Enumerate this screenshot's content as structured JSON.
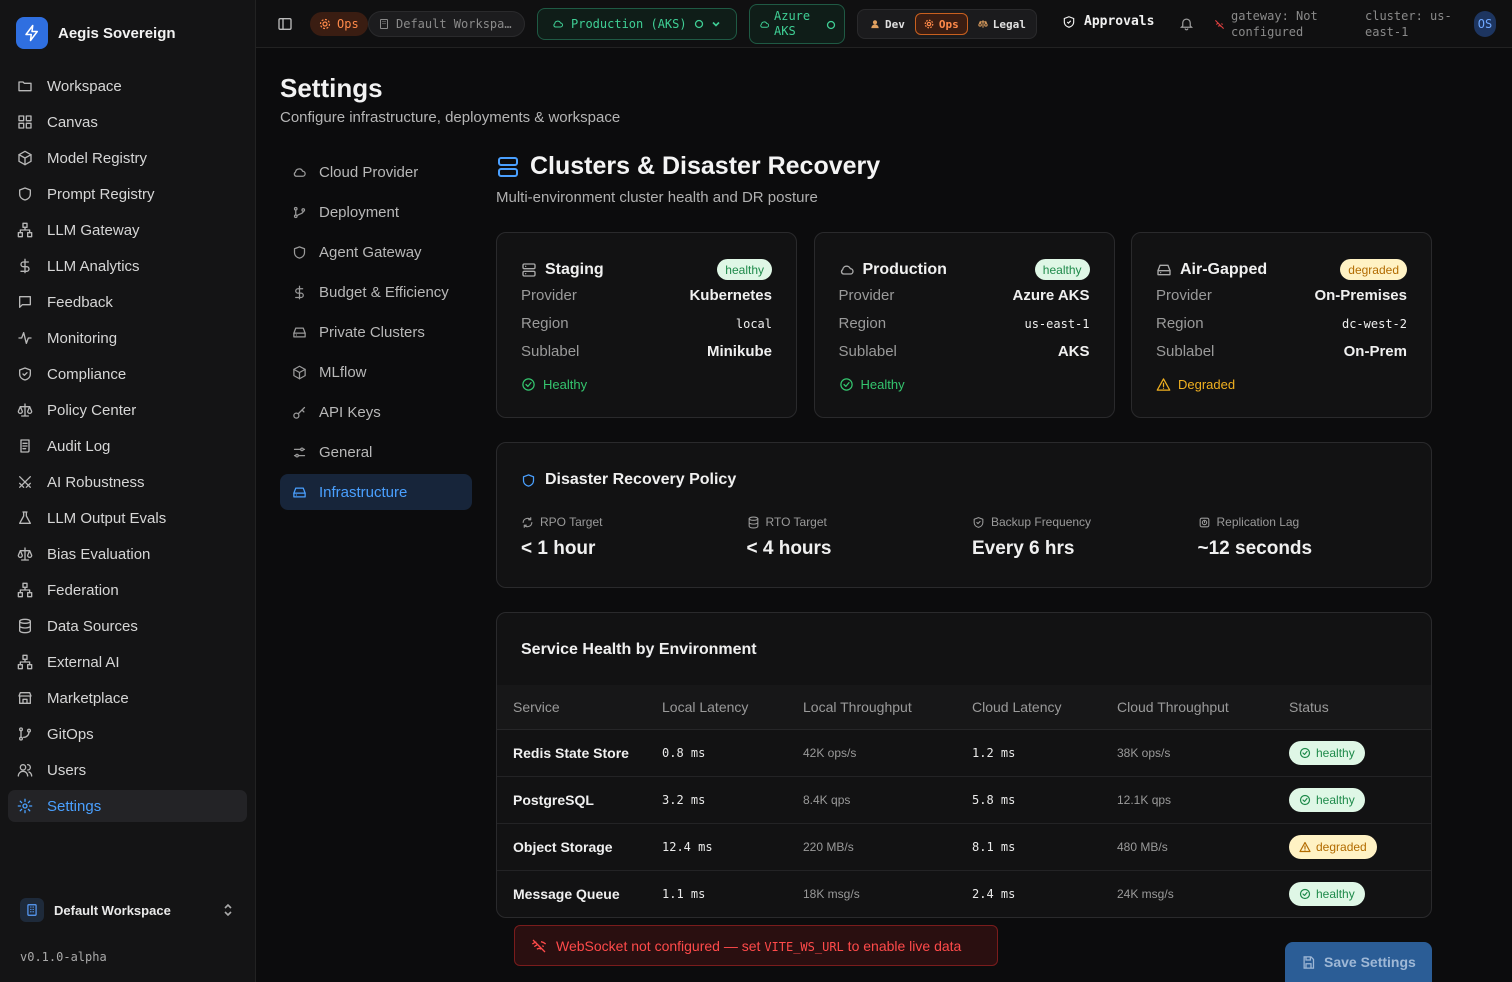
{
  "brand": {
    "name": "Aegis Sovereign"
  },
  "sidebar": {
    "items": [
      {
        "label": "Workspace",
        "icon": "folder-icon",
        "name": "workspace"
      },
      {
        "label": "Canvas",
        "icon": "grid-icon",
        "name": "canvas"
      },
      {
        "label": "Model Registry",
        "icon": "cube-icon",
        "name": "model-registry"
      },
      {
        "label": "Prompt Registry",
        "icon": "shield-icon",
        "name": "prompt-registry"
      },
      {
        "label": "LLM Gateway",
        "icon": "network-icon",
        "name": "llm-gateway"
      },
      {
        "label": "LLM Analytics",
        "icon": "dollar-icon",
        "name": "llm-analytics"
      },
      {
        "label": "Feedback",
        "icon": "message-icon",
        "name": "feedback"
      },
      {
        "label": "Monitoring",
        "icon": "activity-icon",
        "name": "monitoring"
      },
      {
        "label": "Compliance",
        "icon": "shield-check-icon",
        "name": "compliance"
      },
      {
        "label": "Policy Center",
        "icon": "scale-icon",
        "name": "policy-center"
      },
      {
        "label": "Audit Log",
        "icon": "scroll-icon",
        "name": "audit-log"
      },
      {
        "label": "AI Robustness",
        "icon": "swords-icon",
        "name": "ai-robustness"
      },
      {
        "label": "LLM Output Evals",
        "icon": "flask-icon",
        "name": "llm-output-evals"
      },
      {
        "label": "Bias Evaluation",
        "icon": "scale-icon",
        "name": "bias-evaluation"
      },
      {
        "label": "Federation",
        "icon": "network-icon",
        "name": "federation"
      },
      {
        "label": "Data Sources",
        "icon": "database-icon",
        "name": "data-sources"
      },
      {
        "label": "External AI",
        "icon": "network-icon",
        "name": "external-ai"
      },
      {
        "label": "Marketplace",
        "icon": "store-icon",
        "name": "marketplace"
      },
      {
        "label": "GitOps",
        "icon": "git-branch-icon",
        "name": "gitops"
      },
      {
        "label": "Users",
        "icon": "users-icon",
        "name": "users"
      },
      {
        "label": "Settings",
        "icon": "gear-icon",
        "name": "settings",
        "active": true
      }
    ],
    "workspace": "Default Workspace",
    "version": "v0.1.0-alpha"
  },
  "topbar": {
    "role_badge": "Ops",
    "workspace": "Default Workspa…",
    "environment": "Production (AKS)",
    "cloud": "Azure AKS",
    "roles": [
      "Dev",
      "Ops",
      "Legal"
    ],
    "approvals": "Approvals",
    "gateway": "gateway: Not configured",
    "cluster": "cluster: us-east-1",
    "avatar": "OS"
  },
  "page": {
    "title": "Settings",
    "subtitle": "Configure infrastructure, deployments & workspace"
  },
  "settings_nav": [
    {
      "label": "Cloud Provider",
      "icon": "cloud-icon"
    },
    {
      "label": "Deployment",
      "icon": "git-icon"
    },
    {
      "label": "Agent Gateway",
      "icon": "shield-icon"
    },
    {
      "label": "Budget & Efficiency",
      "icon": "dollar-icon"
    },
    {
      "label": "Private Clusters",
      "icon": "hard-drive-icon"
    },
    {
      "label": "MLflow",
      "icon": "cube-icon"
    },
    {
      "label": "API Keys",
      "icon": "key-icon"
    },
    {
      "label": "General",
      "icon": "sliders-icon"
    },
    {
      "label": "Infrastructure",
      "icon": "hard-drive-icon",
      "active": true
    }
  ],
  "section": {
    "title": "Clusters & Disaster Recovery",
    "subtitle": "Multi-environment cluster health and DR posture"
  },
  "clusters": [
    {
      "name": "Staging",
      "badge": "healthy",
      "provider_label": "Provider",
      "provider": "Kubernetes",
      "region_label": "Region",
      "region": "local",
      "sublabel_label": "Sublabel",
      "sublabel": "Minikube",
      "status": "Healthy",
      "state": "healthy"
    },
    {
      "name": "Production",
      "badge": "healthy",
      "provider_label": "Provider",
      "provider": "Azure AKS",
      "region_label": "Region",
      "region": "us-east-1",
      "sublabel_label": "Sublabel",
      "sublabel": "AKS",
      "status": "Healthy",
      "state": "healthy"
    },
    {
      "name": "Air-Gapped",
      "badge": "degraded",
      "provider_label": "Provider",
      "provider": "On-Premises",
      "region_label": "Region",
      "region": "dc-west-2",
      "sublabel_label": "Sublabel",
      "sublabel": "On-Prem",
      "status": "Degraded",
      "state": "degraded"
    }
  ],
  "dr": {
    "title": "Disaster Recovery Policy",
    "metrics": [
      {
        "label": "RPO Target",
        "value": "< 1 hour"
      },
      {
        "label": "RTO Target",
        "value": "< 4 hours"
      },
      {
        "label": "Backup Frequency",
        "value": "Every 6 hrs"
      },
      {
        "label": "Replication Lag",
        "value": "~12 seconds"
      }
    ]
  },
  "service_health": {
    "title": "Service Health by Environment",
    "columns": [
      "Service",
      "Local Latency",
      "Local Throughput",
      "Cloud Latency",
      "Cloud Throughput",
      "Status"
    ],
    "rows": [
      {
        "service": "Redis State Store",
        "local_latency": "0.8 ms",
        "local_throughput": "42K ops/s",
        "cloud_latency": "1.2 ms",
        "cloud_throughput": "38K ops/s",
        "status": "healthy"
      },
      {
        "service": "PostgreSQL",
        "local_latency": "3.2 ms",
        "local_throughput": "8.4K qps",
        "cloud_latency": "5.8 ms",
        "cloud_throughput": "12.1K qps",
        "status": "healthy"
      },
      {
        "service": "Object Storage",
        "local_latency": "12.4 ms",
        "local_throughput": "220 MB/s",
        "cloud_latency": "8.1 ms",
        "cloud_throughput": "480 MB/s",
        "status": "degraded"
      },
      {
        "service": "Message Queue",
        "local_latency": "1.1 ms",
        "local_throughput": "18K msg/s",
        "cloud_latency": "2.4 ms",
        "cloud_throughput": "24K msg/s",
        "status": "healthy"
      }
    ]
  },
  "banner": {
    "pre": "WebSocket not configured — set ",
    "code": "VITE_WS_URL",
    "post": " to enable live data"
  },
  "save_label": "Save Settings",
  "colors": {
    "accent": "#4aa0ff",
    "healthy": "#34c46e",
    "degraded": "#f0b020",
    "error": "#ff4a4a",
    "ops": "#ff8a4a"
  }
}
